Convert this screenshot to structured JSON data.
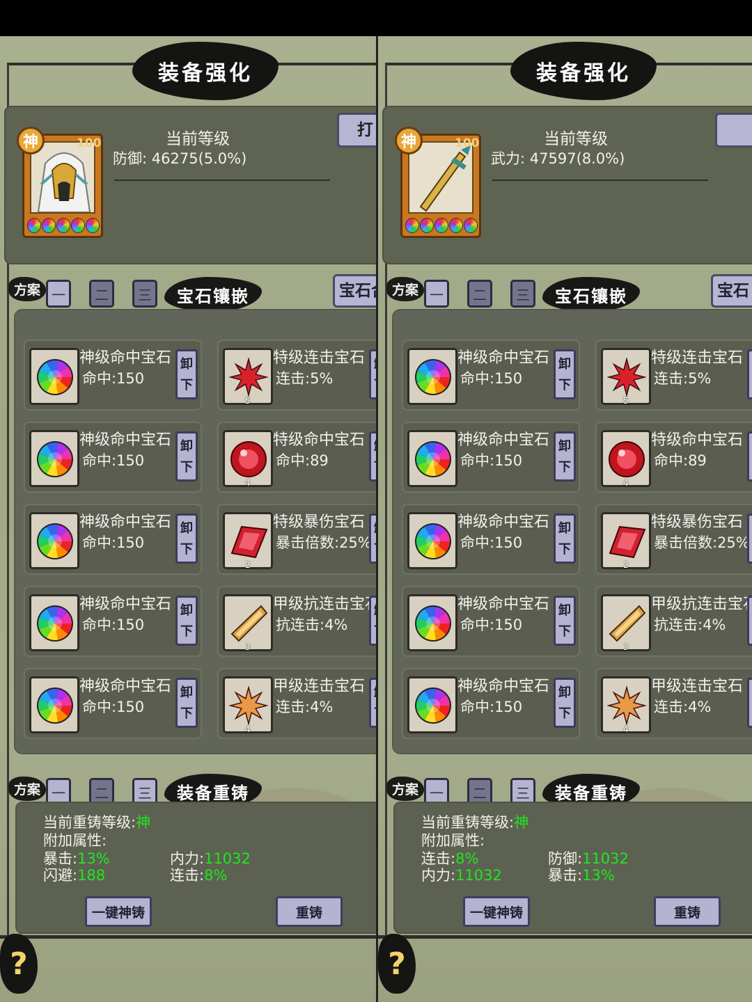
{
  "panels": [
    {
      "title": "装备强化",
      "god_badge": "神",
      "level_tag": "100",
      "current_level_label": "当前等级",
      "stat_label": "防御:",
      "stat_value": "46275(5.0%)",
      "forge_tab": "打",
      "scheme_label": "方案",
      "scheme_buttons": [
        "一",
        "二",
        "三"
      ],
      "gem_section_title": "宝石镶嵌",
      "gem_tab": "宝石合",
      "gems_left": [
        {
          "name": "神级命中宝石",
          "value": "命中:150",
          "kind": "rainbow",
          "count": ""
        },
        {
          "name": "神级命中宝石",
          "value": "命中:150",
          "kind": "rainbow",
          "count": ""
        },
        {
          "name": "神级命中宝石",
          "value": "命中:150",
          "kind": "rainbow",
          "count": ""
        },
        {
          "name": "神级命中宝石",
          "value": "命中:150",
          "kind": "rainbow",
          "count": ""
        },
        {
          "name": "神级命中宝石",
          "value": "命中:150",
          "kind": "rainbow",
          "count": ""
        }
      ],
      "gems_right": [
        {
          "name": "特级连击宝石",
          "value": "连击:5%",
          "kind": "star-red",
          "count": "5"
        },
        {
          "name": "特级命中宝石",
          "value": "命中:89",
          "kind": "red-round",
          "count": "4"
        },
        {
          "name": "特级暴伤宝石",
          "value": "暴击倍数:25%",
          "kind": "red-rhombus",
          "count": "2"
        },
        {
          "name": "甲级抗连击宝石",
          "value": "抗连击:4%",
          "kind": "gold-crystal",
          "count": "3"
        },
        {
          "name": "甲级连击宝石",
          "value": "连击:4%",
          "kind": "star-orange",
          "count": "4"
        }
      ],
      "unload_label": "卸下",
      "recast_title": "装备重铸",
      "recast_level_label": "当前重铸等级:",
      "recast_level_value": "神",
      "extra_attr_label": "附加属性:",
      "attrs": [
        {
          "label": "暴击:",
          "value": "13%"
        },
        {
          "label": "内力:",
          "value": "11032"
        },
        {
          "label": "闪避:",
          "value": "188"
        },
        {
          "label": "连击:",
          "value": "8%"
        }
      ],
      "one_click_label": "一键神铸",
      "recast_label": "重铸",
      "help_label": "?"
    },
    {
      "title": "装备强化",
      "god_badge": "神",
      "level_tag": "100",
      "current_level_label": "当前等级",
      "stat_label": "武力:",
      "stat_value": "47597(8.0%)",
      "forge_tab": "",
      "scheme_label": "方案",
      "scheme_buttons": [
        "一",
        "二",
        "三"
      ],
      "gem_section_title": "宝石镶嵌",
      "gem_tab": "宝石",
      "gems_left": [
        {
          "name": "神级命中宝石",
          "value": "命中:150",
          "kind": "rainbow",
          "count": ""
        },
        {
          "name": "神级命中宝石",
          "value": "命中:150",
          "kind": "rainbow",
          "count": ""
        },
        {
          "name": "神级命中宝石",
          "value": "命中:150",
          "kind": "rainbow",
          "count": ""
        },
        {
          "name": "神级命中宝石",
          "value": "命中:150",
          "kind": "rainbow",
          "count": ""
        },
        {
          "name": "神级命中宝石",
          "value": "命中:150",
          "kind": "rainbow",
          "count": ""
        }
      ],
      "gems_right": [
        {
          "name": "特级连击宝石",
          "value": "连击:5%",
          "kind": "star-red",
          "count": "5"
        },
        {
          "name": "特级命中宝石",
          "value": "命中:89",
          "kind": "red-round",
          "count": "4"
        },
        {
          "name": "特级暴伤宝石",
          "value": "暴击倍数:25%",
          "kind": "red-rhombus",
          "count": "2"
        },
        {
          "name": "甲级抗连击宝石",
          "value": "抗连击:4%",
          "kind": "gold-crystal",
          "count": "3"
        },
        {
          "name": "甲级连击宝石",
          "value": "连击:4%",
          "kind": "star-orange",
          "count": "4"
        }
      ],
      "unload_label": "卸下",
      "recast_title": "装备重铸",
      "recast_level_label": "当前重铸等级:",
      "recast_level_value": "神",
      "extra_attr_label": "附加属性:",
      "attrs": [
        {
          "label": "连击:",
          "value": "8%"
        },
        {
          "label": "防御:",
          "value": "11032"
        },
        {
          "label": "内力:",
          "value": "11032"
        },
        {
          "label": "暴击:",
          "value": "13%"
        }
      ],
      "one_click_label": "一键神铸",
      "recast_label": "重铸",
      "help_label": "?"
    }
  ],
  "colors": {
    "attr_value": "#1ee81e",
    "panel_bg": "#a6ad8c",
    "card_bg": "#5a5d50",
    "button_bg": "#b4b4d2"
  }
}
